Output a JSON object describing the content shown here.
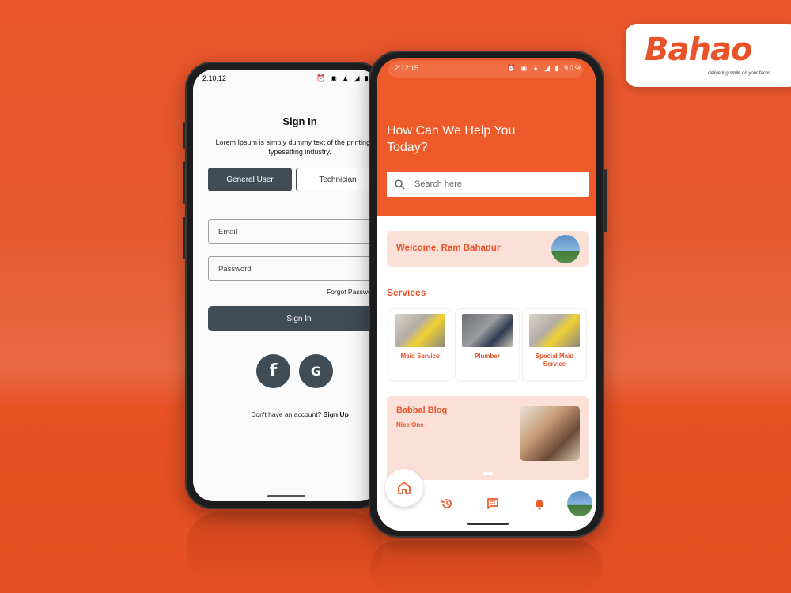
{
  "brand": {
    "name": "Bahao",
    "tagline": "delivering smile on your faces",
    "color": "#e8532a"
  },
  "left_phone": {
    "status": {
      "time": "2:10:12",
      "icons": "⏰ ◉ ▲ ◢ ▮"
    },
    "title": "Sign In",
    "description": "Lorem Ipsum is simply dummy text of the printing and typesetting industry.",
    "tabs": {
      "general": "General User",
      "technician": "Technician"
    },
    "email_placeholder": "Email",
    "password_placeholder": "Password",
    "forgot": "Forgot Password",
    "signin": "Sign In",
    "social": {
      "facebook": "f",
      "google": "G"
    },
    "signup_prompt": "Don't have an account?",
    "signup_link": "Sign Up",
    "accent": "#3f4b55"
  },
  "right_phone": {
    "status": {
      "time": "2:12:15",
      "icons": "⏰ ◉ ▲ ◢ ▮ 90%"
    },
    "heading": "How Can We Help You Today?",
    "search_placeholder": "Search here",
    "welcome": "Welcome, Ram Bahadur",
    "services_title": "Services",
    "services": [
      {
        "label": "Maid Service"
      },
      {
        "label": "Plumber"
      },
      {
        "label": "Special Maid Service"
      }
    ],
    "blog": {
      "title": "Babbal Blog",
      "subtitle": "Nice One"
    },
    "nav": [
      "home-icon",
      "history-icon",
      "chat-icon",
      "bell-icon",
      "avatar"
    ],
    "accent": "#ef5a2a"
  }
}
